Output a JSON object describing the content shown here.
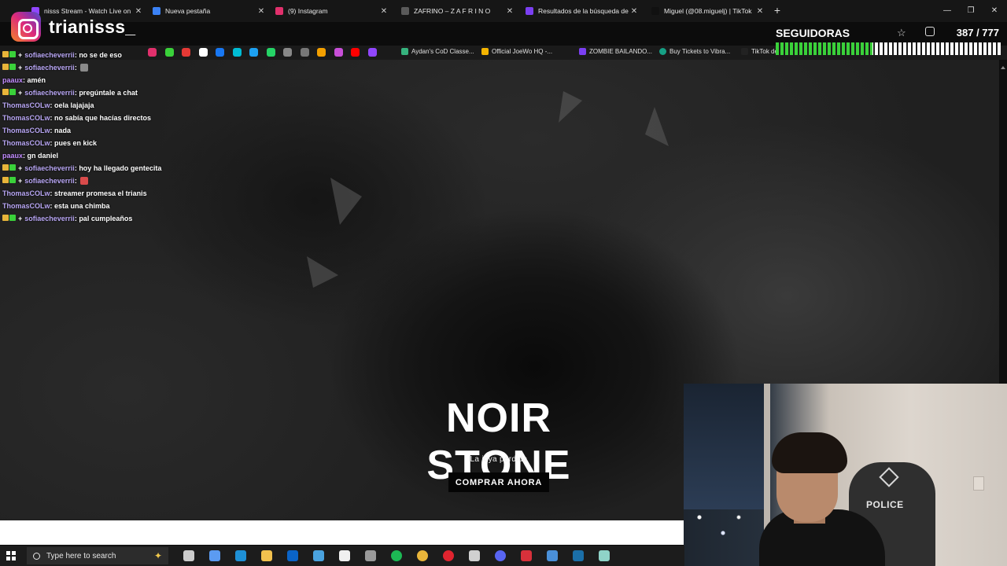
{
  "browser": {
    "tabs": [
      {
        "title": "nisss Stream - Watch Live on",
        "fav_color": "#9146ff"
      },
      {
        "title": "Nueva pestaña",
        "fav_color": "#3b82f6"
      },
      {
        "title": "(9) Instagram",
        "fav_color": "#e1306c"
      },
      {
        "title": "ZAFRINO – Z A F R I N O",
        "fav_color": "#5a5a5a"
      },
      {
        "title": "Resultados de la búsqueda de",
        "fav_color": "#7b3ff2"
      },
      {
        "title": "Miguel (@08.miguelj) | TikTok",
        "fav_color": "#111111"
      }
    ],
    "new_tab_glyph": "+",
    "window_controls": [
      "—",
      "❐",
      "✕"
    ],
    "bookmarks": [
      {
        "label": "Aydan's CoD Classe...",
        "color": "#36b37e"
      },
      {
        "label": "Official JoeWo HQ -...",
        "color": "#f4b400"
      },
      {
        "label": "ZOMBIE BAILANDO...",
        "color": "#7b3ff2"
      },
      {
        "label": "Buy Tickets to Vibra...",
        "color": "#16a085"
      },
      {
        "label": "TikTok de",
        "color": "#111111"
      }
    ],
    "bookmark_icon_colors": [
      "#e1306c",
      "#3ad13a",
      "#e53935",
      "#ffffff",
      "#1877f2",
      "#00bcd4",
      "#1da1f2",
      "#25d366",
      "#888888",
      "#777777",
      "#f4a000",
      "#c84fd8",
      "#ff0000",
      "#9146ff"
    ]
  },
  "overlay": {
    "instagram_icon": "instagram-icon",
    "handle": "trianisss_",
    "goal_label": "SEGUIDORAS",
    "goal_count": "387 / 777",
    "goal_progress": 0.43
  },
  "chat": [
    {
      "user": "sofiaecheverrii",
      "user_color": "#b9a7f5",
      "badges": true,
      "text": "no se de eso"
    },
    {
      "user": "sofiaecheverrii",
      "user_color": "#b9a7f5",
      "badges": true,
      "text": "",
      "emote": "#8a8a8a"
    },
    {
      "user": "paaux",
      "user_color": "#c28cff",
      "badges": false,
      "text": "amén"
    },
    {
      "user": "sofiaecheverrii",
      "user_color": "#b9a7f5",
      "badges": true,
      "text": "pregúntale a chat"
    },
    {
      "user": "ThomasCOLw",
      "user_color": "#b9a7f5",
      "badges": false,
      "text": "oela lajajaja"
    },
    {
      "user": "ThomasCOLw",
      "user_color": "#b9a7f5",
      "badges": false,
      "text": "no sabía que hacías directos"
    },
    {
      "user": "ThomasCOLw",
      "user_color": "#b9a7f5",
      "badges": false,
      "text": "nada"
    },
    {
      "user": "ThomasCOLw",
      "user_color": "#b9a7f5",
      "badges": false,
      "text": "pues en kick"
    },
    {
      "user": "paaux",
      "user_color": "#c28cff",
      "badges": false,
      "text": "gn daniel"
    },
    {
      "user": "sofiaecheverrii",
      "user_color": "#b9a7f5",
      "badges": true,
      "text": "hoy ha llegado gentecita"
    },
    {
      "user": "sofiaecheverrii",
      "user_color": "#b9a7f5",
      "badges": true,
      "text": "",
      "emote": "#d94b4b"
    },
    {
      "user": "ThomasCOLw",
      "user_color": "#b9a7f5",
      "badges": false,
      "text": "streamer promesa el trianis"
    },
    {
      "user": "ThomasCOLw",
      "user_color": "#b9a7f5",
      "badges": false,
      "text": "esta una chimba"
    },
    {
      "user": "sofiaecheverrii",
      "user_color": "#b9a7f5",
      "badges": true,
      "text": "pal cumpleaños"
    }
  ],
  "hero": {
    "title": "NOIR STONE",
    "subtitle": "La joya perdida",
    "cta": "COMPRAR AHORA"
  },
  "webcam": {
    "chair_text": "POLICE"
  },
  "taskbar": {
    "search_placeholder": "Type here to search",
    "icons": [
      {
        "name": "task-view-icon",
        "color": "#cccccc"
      },
      {
        "name": "copilot-icon",
        "color": "#5b9bf2"
      },
      {
        "name": "edge-icon",
        "color": "#1e90d6"
      },
      {
        "name": "file-explorer-icon",
        "color": "#f2c14e"
      },
      {
        "name": "outlook-icon",
        "color": "#0a64c8"
      },
      {
        "name": "teams-icon",
        "color": "#4aa3df"
      },
      {
        "name": "store-icon",
        "color": "#f0f0f0"
      },
      {
        "name": "calculator-icon",
        "color": "#9a9a9a"
      },
      {
        "name": "spotify-icon",
        "color": "#1db954"
      },
      {
        "name": "chrome-icon",
        "color": "#e8b53a"
      },
      {
        "name": "opera-icon",
        "color": "#e0242f"
      },
      {
        "name": "obs-icon",
        "color": "#d0d0d0"
      },
      {
        "name": "discord-icon",
        "color": "#5865f2"
      },
      {
        "name": "app-red-icon",
        "color": "#d8313b"
      },
      {
        "name": "security-icon",
        "color": "#4a90d9"
      },
      {
        "name": "steam-icon",
        "color": "#1b6fa8"
      },
      {
        "name": "notes-icon",
        "color": "#8fd3c8"
      }
    ]
  }
}
